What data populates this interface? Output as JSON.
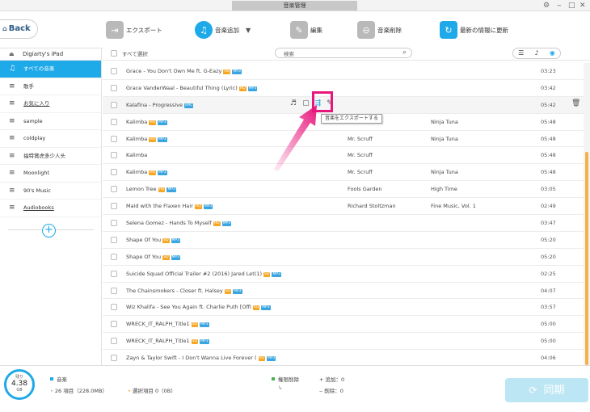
{
  "window": {
    "title": "音楽管理",
    "controls": [
      "⚙",
      "‒",
      "□",
      "✕"
    ]
  },
  "toolbar": {
    "back_label": "Back",
    "export_label": "エクスポート",
    "add_label": "音楽追加",
    "edit_label": "編集",
    "delete_label": "音楽削除",
    "refresh_label": "最新の情報に更新"
  },
  "sidebar": {
    "device_name": "Digiarty's iPad",
    "items": [
      {
        "label": "すべての音楽",
        "active": true
      },
      {
        "label": "歌手"
      },
      {
        "label": "お気に入り"
      },
      {
        "label": "sample"
      },
      {
        "label": "coldplay"
      },
      {
        "label": "福特賞虎多少人头"
      },
      {
        "label": "Moonlight"
      },
      {
        "label": "90's Music"
      },
      {
        "label": "Audiobooks"
      }
    ]
  },
  "list_header": {
    "select_all": "すべて選択",
    "search_placeholder": "検索"
  },
  "tooltip": "音楽をエクスポートする",
  "tracks": [
    {
      "title": "Grace - You Don't Own Me ft. G-Eazy",
      "hq": "HQ",
      "fmt": "MP3",
      "artist": "",
      "album": "",
      "duration": "03:23"
    },
    {
      "title": "Grace VanderWaal - Beautiful Thing (Lyric)",
      "hq": "HQ",
      "fmt": "MP3",
      "artist": "",
      "album": "",
      "duration": "03:42"
    },
    {
      "title": "Kalafina - Progressive",
      "hq": "",
      "fmt": "AAC",
      "artist": "",
      "album": "",
      "duration": "05:42"
    },
    {
      "title": "Kalimba",
      "hq": "HQ",
      "fmt": "MP3",
      "artist": "",
      "album": "Ninja Tuna",
      "duration": "05:48"
    },
    {
      "title": "Kalimba",
      "hq": "HQ",
      "fmt": "MP3",
      "artist": "Mr. Scruff",
      "album": "Ninja Tuna",
      "duration": "05:48"
    },
    {
      "title": "Kalimba",
      "hq": "",
      "fmt": "",
      "artist": "Mr. Scruff",
      "album": "",
      "duration": "05:48"
    },
    {
      "title": "Kalimba",
      "hq": "HQ",
      "fmt": "MP3",
      "artist": "Mr. Scruff",
      "album": "Ninja Tuna",
      "duration": "05:48"
    },
    {
      "title": "Lemon Tree",
      "hq": "HQ",
      "fmt": "MP3",
      "artist": "Fools Garden",
      "album": "High Time",
      "duration": "03:05"
    },
    {
      "title": "Maid with the Flaxen Hair",
      "hq": "HQ",
      "fmt": "MP3",
      "artist": "Richard Stoltzman",
      "album": "Fine Music, Vol. 1",
      "duration": "02:49"
    },
    {
      "title": "Selena Gomez - Hands To Myself",
      "hq": "HQ",
      "fmt": "MP3",
      "artist": "",
      "album": "",
      "duration": "03:47"
    },
    {
      "title": "Shape Of You",
      "hq": "SQ",
      "fmt": "MP3",
      "artist": "",
      "album": "",
      "duration": "05:20"
    },
    {
      "title": "Shape Of You",
      "hq": "SQ",
      "fmt": "MP3",
      "artist": "",
      "album": "",
      "duration": "05:20"
    },
    {
      "title": "Suicide Squad Official Trailer #2 (2016) Jared Let(1)",
      "hq": "SQ",
      "fmt": "MP3",
      "artist": "",
      "album": "",
      "duration": "02:25"
    },
    {
      "title": "The Chainsmokers - Closer ft. Halsey",
      "hq": "SQ",
      "fmt": "MP3",
      "artist": "",
      "album": "",
      "duration": "04:07"
    },
    {
      "title": "Wiz Khalifa - See You Again ft. Charlie Puth [Offi",
      "hq": "SQ",
      "fmt": "MP3",
      "artist": "",
      "album": "",
      "duration": "03:57"
    },
    {
      "title": "WRECK_IT_RALPH_Title1",
      "hq": "SQ",
      "fmt": "MP3",
      "artist": "",
      "album": "",
      "duration": "05:00"
    },
    {
      "title": "WRECK_IT_RALPH_Title1",
      "hq": "SQ",
      "fmt": "MP3",
      "artist": "",
      "album": "",
      "duration": "05:00"
    },
    {
      "title": "Zayn & Taylor Swift - I Don't Wanna Live Forever (",
      "hq": "SQ",
      "fmt": "MP3",
      "artist": "",
      "album": "",
      "duration": "04:06"
    }
  ],
  "footer": {
    "storage_label": "残り",
    "storage_value": "4.38",
    "storage_unit": "GB",
    "category": "音楽",
    "items_text": "26 項目（228.0MB）",
    "selected_text": "選択項目 0（0B）",
    "pending_delete_label": "権限削除",
    "add_count": "追加：0",
    "delete_count": "削除：0",
    "sync_label": "同期"
  },
  "colors": {
    "accent": "#1ea9e8",
    "highlight": "#e8177d",
    "hq_badge": "#f5a623",
    "scroll_thumb": "#f6b04a"
  }
}
